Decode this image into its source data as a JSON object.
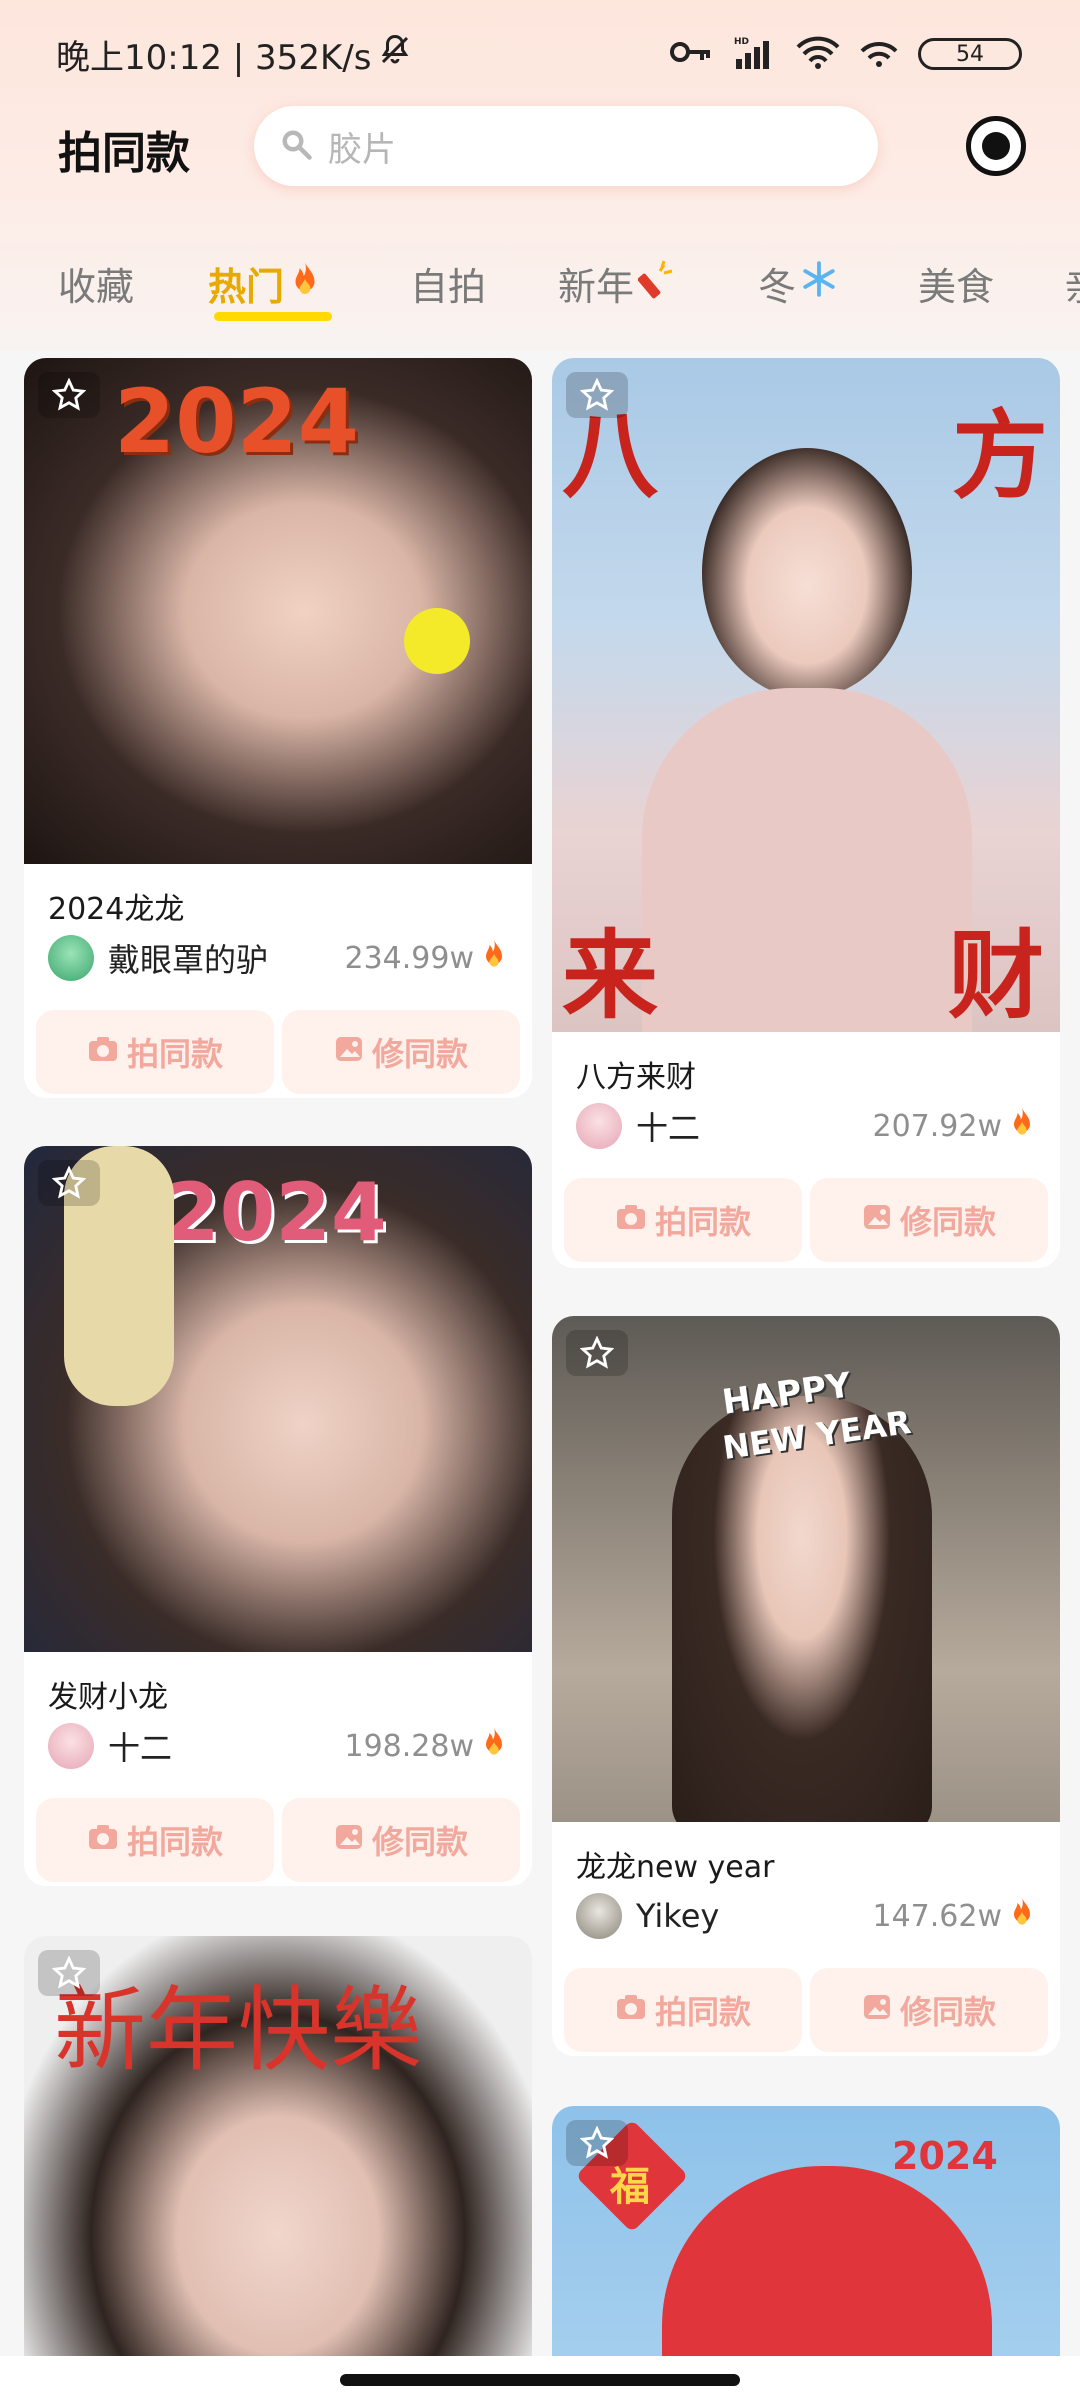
{
  "status_bar": {
    "time_speed": "晚上10:12 | 352K/s",
    "battery": "54"
  },
  "header": {
    "title": "拍同款",
    "search_placeholder": "胶片"
  },
  "tabs": [
    {
      "label": "收藏"
    },
    {
      "label": "热门"
    },
    {
      "label": "自拍"
    },
    {
      "label": "新年"
    },
    {
      "label": "冬"
    },
    {
      "label": "美食"
    },
    {
      "label": "亲"
    }
  ],
  "buttons": {
    "shoot": "拍同款",
    "edit": "修同款"
  },
  "cards": [
    {
      "title": "2024龙龙",
      "author": "戴眼罩的驴",
      "count": "234.99w",
      "photo_text": "2024"
    },
    {
      "title": "八方来财",
      "author": "十二",
      "count": "207.92w",
      "photo_text_1": "八",
      "photo_text_2": "方",
      "photo_text_3": "来",
      "photo_text_4": "财"
    },
    {
      "title": "发财小龙",
      "author": "十二",
      "count": "198.28w",
      "photo_text": "2024"
    },
    {
      "title": "龙龙new year",
      "author": "Yikey",
      "count": "147.62w",
      "photo_text_1": "HAPPY",
      "photo_text_2": "NEW YEAR"
    },
    {
      "title": "",
      "author": "",
      "count": "",
      "photo_text": "新年快樂"
    },
    {
      "title": "",
      "author": "",
      "count": "",
      "photo_text_1": "福",
      "photo_text_2": "2024"
    }
  ],
  "colors": {
    "accent": "#e8a900",
    "tab_underline": "#ffd900",
    "button_bg": "#fff1ec",
    "button_text": "#f2a89c",
    "fire": "#ff6a1a"
  },
  "icons": [
    "bell-off-icon",
    "key-icon",
    "signal-icon",
    "wifi-icon",
    "hotspot-icon",
    "battery-icon",
    "search-icon",
    "record-icon",
    "star-icon",
    "camera-icon",
    "image-edit-icon",
    "fire-icon",
    "firecracker-icon",
    "snowflake-icon"
  ]
}
